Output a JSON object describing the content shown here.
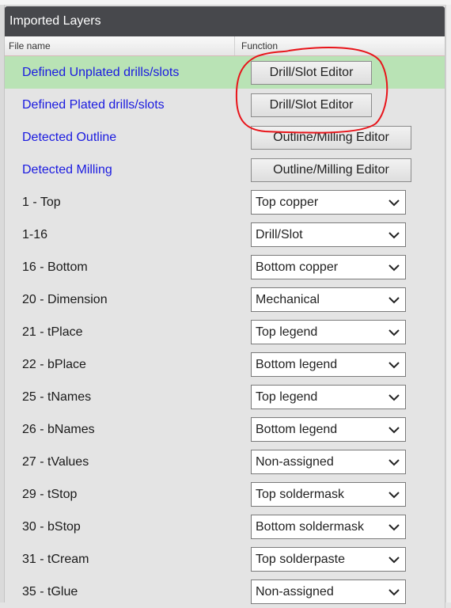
{
  "panel": {
    "title": "Imported Layers",
    "columns": {
      "file_name": "File name",
      "function": "Function"
    }
  },
  "editor_rows": [
    {
      "name": "Defined Unplated drills/slots",
      "button": "Drill/Slot Editor",
      "highlighted": true
    },
    {
      "name": "Defined Plated drills/slots",
      "button": "Drill/Slot Editor",
      "highlighted": false
    },
    {
      "name": "Detected Outline",
      "button": "Outline/Milling Editor",
      "highlighted": false
    },
    {
      "name": "Detected Milling",
      "button": "Outline/Milling Editor",
      "highlighted": false
    }
  ],
  "layer_rows": [
    {
      "name": "1 - Top",
      "function": "Top copper"
    },
    {
      "name": "1-16",
      "function": "Drill/Slot"
    },
    {
      "name": "16 - Bottom",
      "function": "Bottom copper"
    },
    {
      "name": "20 - Dimension",
      "function": "Mechanical"
    },
    {
      "name": "21 - tPlace",
      "function": "Top legend"
    },
    {
      "name": "22 - bPlace",
      "function": "Bottom legend"
    },
    {
      "name": "25 - tNames",
      "function": "Top legend"
    },
    {
      "name": "26 - bNames",
      "function": "Bottom legend"
    },
    {
      "name": "27 - tValues",
      "function": "Non-assigned"
    },
    {
      "name": "29 - tStop",
      "function": "Top soldermask"
    },
    {
      "name": "30 - bStop",
      "function": "Bottom soldermask"
    },
    {
      "name": "31 - tCream",
      "function": "Top solderpaste"
    },
    {
      "name": "35 - tGlue",
      "function": "Non-assigned"
    }
  ],
  "colors": {
    "title_bg": "#47484c",
    "highlight_row": "#b9e3b5",
    "link_text": "#1a1ae0",
    "annotation": "#e8141a"
  }
}
